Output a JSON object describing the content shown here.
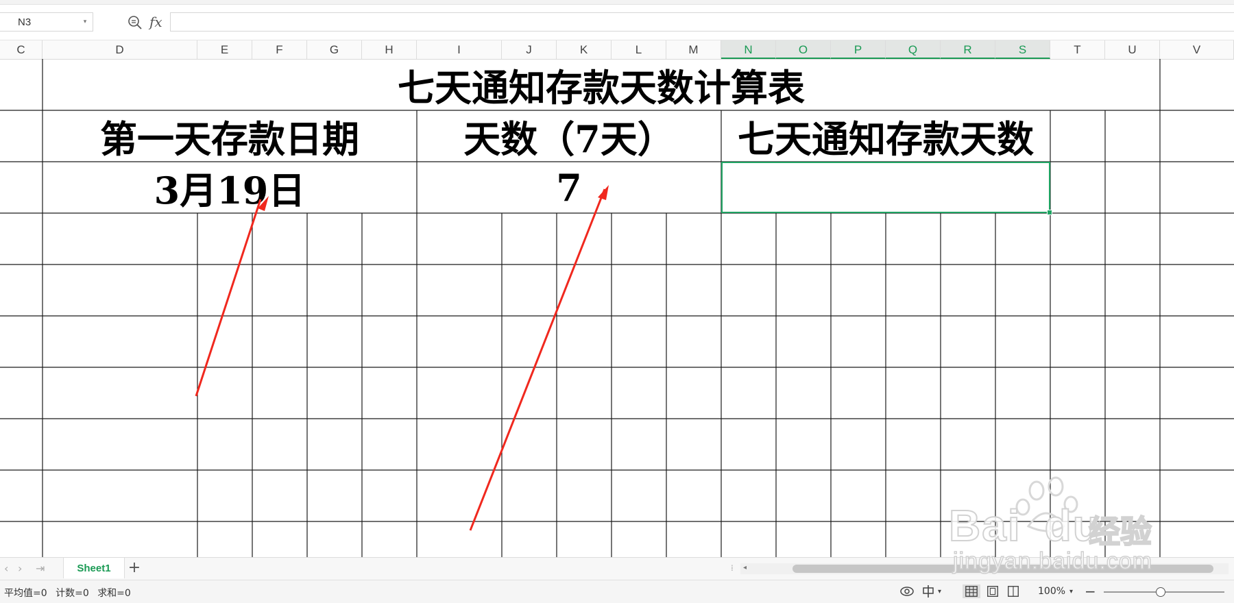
{
  "formula_bar": {
    "cell_reference": "N3",
    "formula_icon": "fx",
    "formula_value": ""
  },
  "column_headers": [
    "C",
    "D",
    "E",
    "F",
    "G",
    "H",
    "I",
    "J",
    "K",
    "L",
    "M",
    "N",
    "O",
    "P",
    "Q",
    "R",
    "S",
    "T",
    "U",
    "V"
  ],
  "selected_columns": [
    "N",
    "O",
    "P",
    "Q",
    "R",
    "S"
  ],
  "sheet": {
    "title": "七天通知存款天数计算表",
    "header_first_day": "第一天存款日期",
    "header_days": "天数（7天）",
    "header_notice_days": "七天通知存款天数",
    "value_first_day": "3月19日",
    "value_days": "7",
    "value_notice_days": ""
  },
  "tabs": {
    "sheet_name": "Sheet1",
    "add_label": "+"
  },
  "status": {
    "average": "平均值=0",
    "count": "计数=0",
    "sum": "求和=0",
    "zoom": "100%"
  },
  "watermark": {
    "brand": "Bai",
    "brand2": "du",
    "brand_cn": "经验",
    "url": "jingyan.baidu.com"
  },
  "colors": {
    "accent": "#1a9a54",
    "selection": "#1fa463",
    "arrow": "#f0281e"
  }
}
